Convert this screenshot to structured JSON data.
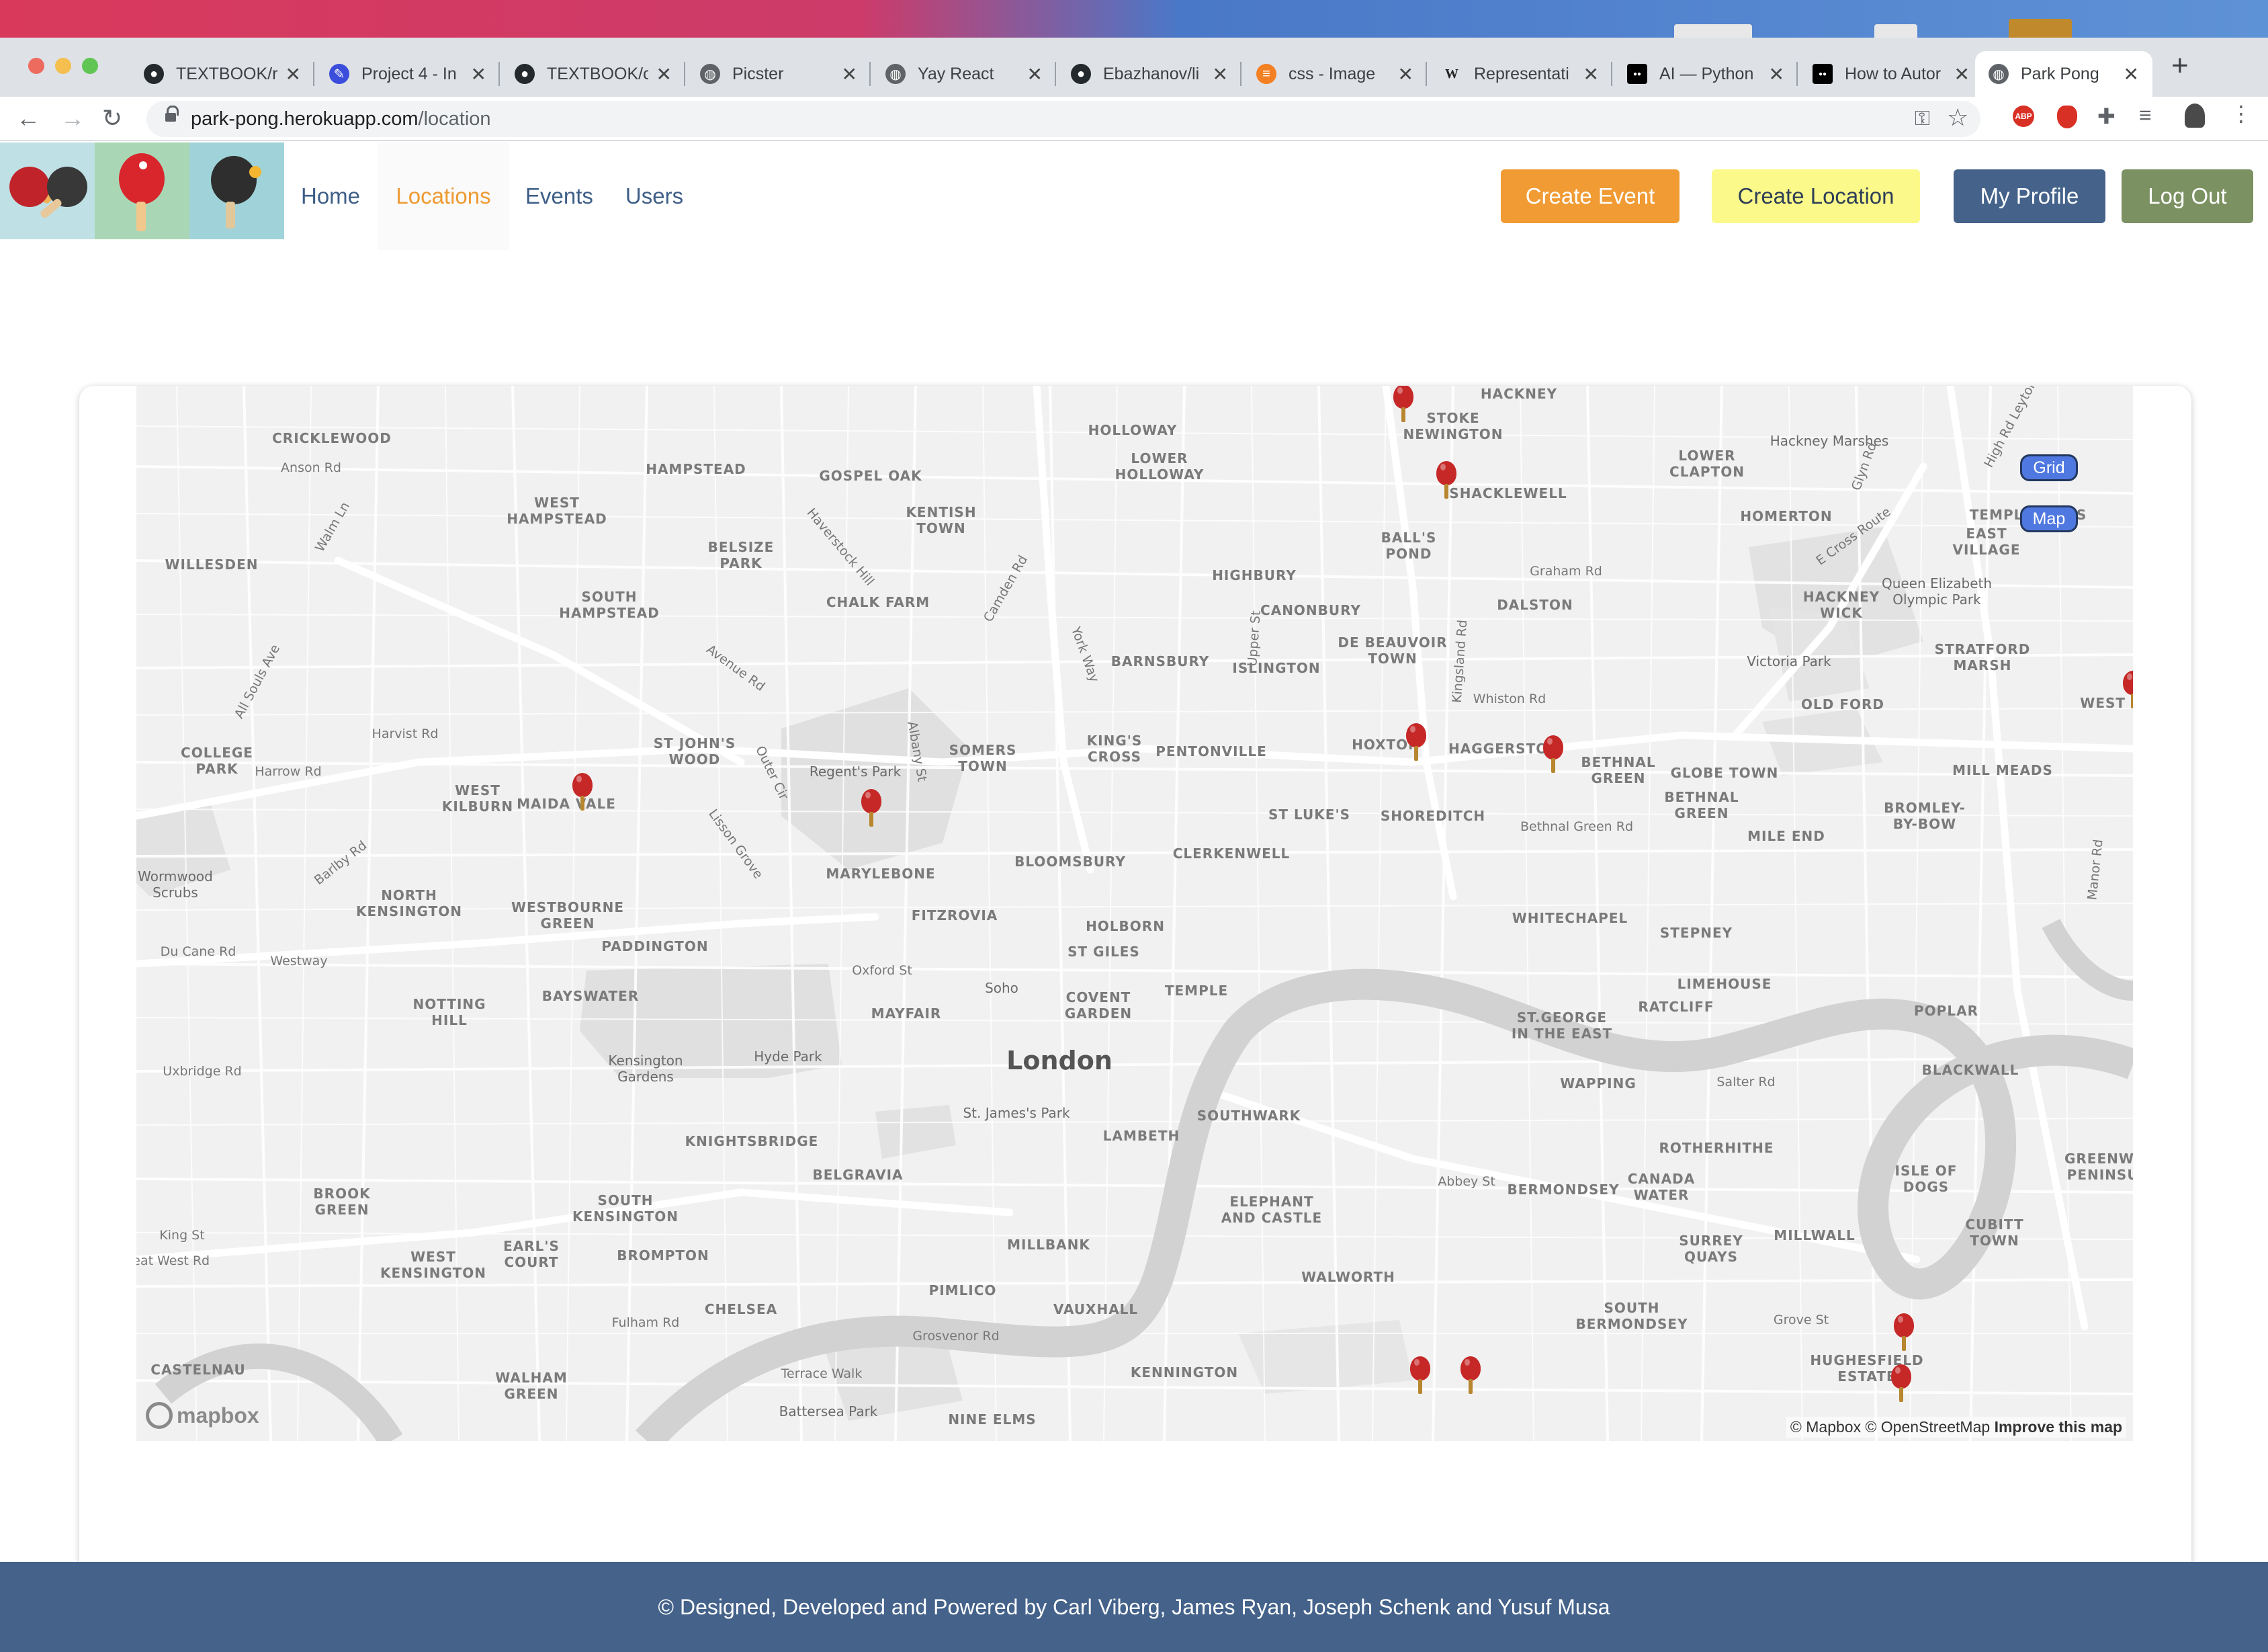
{
  "browser": {
    "tabs": [
      {
        "title": "TEXTBOOK/r",
        "icon": "github-icon",
        "color": "#24292e"
      },
      {
        "title": "Project 4 - In",
        "icon": "project-icon",
        "color": "#3b4ddb"
      },
      {
        "title": "TEXTBOOK/c",
        "icon": "github-icon",
        "color": "#24292e"
      },
      {
        "title": "Picster",
        "icon": "globe-icon",
        "color": "#5f6368"
      },
      {
        "title": "Yay React",
        "icon": "globe-icon",
        "color": "#5f6368"
      },
      {
        "title": "Ebazhanov/li",
        "icon": "github-icon",
        "color": "#24292e"
      },
      {
        "title": "css - Image",
        "icon": "stackoverflow-icon",
        "color": "#f48024"
      },
      {
        "title": "Representati",
        "icon": "wikipedia-icon",
        "color": "#222222"
      },
      {
        "title": "AI — Python",
        "icon": "medium-icon",
        "color": "#000000"
      },
      {
        "title": "How to Autor",
        "icon": "medium-icon",
        "color": "#000000"
      },
      {
        "title": "Park Pong",
        "icon": "globe-icon",
        "color": "#5f6368"
      }
    ],
    "active_tab": 10,
    "close_glyph": "✕",
    "new_tab_glyph": "+",
    "url_host": "park-pong.herokuapp.com",
    "url_path": "/location",
    "toolbar_icons": [
      "key-icon",
      "star-icon",
      "adblock-icon",
      "shield-icon",
      "extensions-icon",
      "reading-list-icon",
      "profile-icon",
      "menu-icon"
    ]
  },
  "header": {
    "nav": {
      "home": "Home",
      "locations": "Locations",
      "events": "Events",
      "users": "Users"
    },
    "buttons": {
      "create_event": "Create Event",
      "create_location": "Create Location",
      "my_profile": "My Profile",
      "log_out": "Log Out"
    },
    "colors": {
      "create_event": "#f09b33",
      "create_location": "#fbf98a",
      "my_profile": "#44628a",
      "log_out": "#7b9162"
    }
  },
  "map": {
    "toggle_grid": "Grid",
    "toggle_map": "Map",
    "mapbox_logo": "mapbox",
    "attribution": "© Mapbox © OpenStreetMap",
    "improve": "Improve this map",
    "labels": {
      "cricklewood": "CRICKLEWOOD",
      "anson_rd": "Anson Rd",
      "hampstead": "HAMPSTEAD",
      "gospel_oak": "GOSPEL OAK",
      "west_hampstead": "WEST\nHAMPSTEAD",
      "kentish_town": "KENTISH\nTOWN",
      "holloway": "HOLLOWAY",
      "lower_holloway": "LOWER\nHOLLOWAY",
      "hackney": "HACKNEY",
      "stoke_newington": "STOKE\nNEWINGTON",
      "shacklewell": "SHACKLEWELL",
      "lower_clapton": "LOWER\nCLAPTON",
      "hackney_marshes": "Hackney Marshes",
      "homerton": "HOMERTON",
      "east_village": "EAST\nVILLAGE",
      "temple_mills": "TEMPLE MILLS",
      "willesden": "WILLESDEN",
      "belsize_park": "BELSIZE\nPARK",
      "chalk_farm": "CHALK FARM",
      "highbury": "HIGHBURY",
      "balls_pond": "BALL'S\nPOND",
      "graham_rd": "Graham Rd",
      "dalston": "DALSTON",
      "canonbury": "CANONBURY",
      "de_beauvoir": "DE BEAUVOIR\nTOWN",
      "hackney_wick": "HACKNEY\nWICK",
      "olympic_park": "Queen Elizabeth\nOlympic Park",
      "south_hampstead": "SOUTH\nHAMPSTEAD",
      "barnsbury": "BARNSBURY",
      "islington": "ISLINGTON",
      "victoria_park": "Victoria Park",
      "stratford_marsh": "STRATFORD\nMARSH",
      "whiston_rd": "Whiston Rd",
      "old_ford": "OLD FORD",
      "west_ham": "WEST H",
      "college_park": "COLLEGE\nPARK",
      "harrow_rd": "Harrow Rd",
      "harvist_rd": "Harvist Rd",
      "st_johns_wood": "ST JOHN'S\nWOOD",
      "west_kilburn": "WEST\nKILBURN",
      "maida_vale": "MAIDA VALE",
      "regents_park": "Regent's Park",
      "somers_town": "SOMERS\nTOWN",
      "kings_cross": "KING'S\nCROSS",
      "pentonville": "PENTONVILLE",
      "hoxton": "HOXTON",
      "haggerston": "HAGGERSTON",
      "bethnal_green": "BETHNAL\nGREEN",
      "globe_town": "GLOBE TOWN",
      "mill_meads": "MILL MEADS",
      "wormwood_scrubs": "Wormwood\nScrubs",
      "north_kensington": "NORTH\nKENSINGTON",
      "westbourne_green": "WESTBOURNE\nGREEN",
      "marylebone": "MARYLEBONE",
      "bloomsbury": "BLOOMSBURY",
      "clerkenwell": "CLERKENWELL",
      "st_lukes": "ST LUKE'S",
      "shoreditch": "SHOREDITCH",
      "bethnal_green_rd": "Bethnal Green Rd",
      "bethnal_green2": "BETHNAL\nGREEN",
      "mile_end": "MILE END",
      "bromley_by_bow": "BROMLEY-\nBY-BOW",
      "du_cane_rd": "Du Cane Rd",
      "westway": "Westway",
      "paddington": "PADDINGTON",
      "fitzrovia": "FITZROVIA",
      "holborn": "HOLBORN",
      "st_giles": "ST GILES",
      "whitechapel": "WHITECHAPEL",
      "stepney": "STEPNEY",
      "notting_hill": "NOTTING\nHILL",
      "bayswater": "BAYSWATER",
      "oxford_st": "Oxford St",
      "soho": "Soho",
      "mayfair": "MAYFAIR",
      "covent_garden": "COVENT\nGARDEN",
      "temple": "TEMPLE",
      "limehouse": "LIMEHOUSE",
      "ratcliff": "RATCLIFF",
      "poplar": "POPLAR",
      "st_george": "ST.GEORGE\nIN THE EAST",
      "uxbridge_rd": "Uxbridge Rd",
      "kensington_gardens": "Kensington\nGardens",
      "hyde_park": "Hyde Park",
      "london": "London",
      "st_james_park": "St. James's Park",
      "wapping": "WAPPING",
      "salter_rd": "Salter Rd",
      "blackwall": "BLACKWALL",
      "knightsbridge": "KNIGHTSBRIDGE",
      "lambeth": "LAMBETH",
      "southwark": "SOUTHWARK",
      "rotherhithe": "ROTHERHITHE",
      "greenwich_peninsula": "GREENWIC\nPENINSUL",
      "belgravia": "BELGRAVIA",
      "isle_of_dogs": "ISLE OF\nDOGS",
      "brook_green": "BROOK\nGREEN",
      "south_kensington": "SOUTH\nKENSINGTON",
      "elephant_castle": "ELEPHANT\nAND CASTLE",
      "abbey_st": "Abbey St",
      "bermondsey": "BERMONDSEY",
      "canada_water": "CANADA\nWATER",
      "millwall": "MILLWALL",
      "cubitt_town": "CUBITT\nTOWN",
      "king_st": "King St",
      "earls_court": "EARL'S\nCOURT",
      "millbank": "MILLBANK",
      "west_kensington": "WEST\nKENSINGTON",
      "brompton": "BROMPTON",
      "walworth": "WALWORTH",
      "surrey_quays": "SURREY\nQUAYS",
      "great_west_rd": "reat West Rd",
      "pimlico": "PIMLICO",
      "chelsea": "CHELSEA",
      "vauxhall": "VAUXHALL",
      "fulham_rd": "Fulham Rd",
      "grosvenor_rd": "Grosvenor Rd",
      "south_bermondsey": "SOUTH\nBERMONDSEY",
      "grove_st": "Grove St",
      "castelnau": "CASTELNAU",
      "walham_green": "WALHAM\nGREEN",
      "terrace_walk": "Terrace Walk",
      "battersea_park": "Battersea Park",
      "kennington": "KENNINGTON",
      "nine_elms": "NINE ELMS",
      "hughesfield": "HUGHESFIELD\nESTATE",
      "high_rd_leyton": "High Rd Leyton",
      "glyn_rd": "Glyn Rd",
      "e_cross_route": "E Cross Route",
      "camden_rd": "Camden Rd",
      "york_way": "York Way",
      "upper_st": "Upper St",
      "kingsland_rd": "Kingsland Rd",
      "avenue_rd": "Avenue Rd",
      "outer_cir": "Outer Cir",
      "albany_st": "Albany St",
      "lisson_grove": "Lisson Grove",
      "barlby_rd": "Barlby Rd",
      "all_souls_ave": "All Souls Ave",
      "walm_ln": "Walm Ln",
      "haverstock_hill": "Haverstock Hill",
      "manor_rd": "Manor Rd"
    }
  },
  "footer": {
    "text": "© Designed, Developed and Powered by Carl Viberg, James Ryan, Joseph Schenk and Yusuf Musa"
  }
}
